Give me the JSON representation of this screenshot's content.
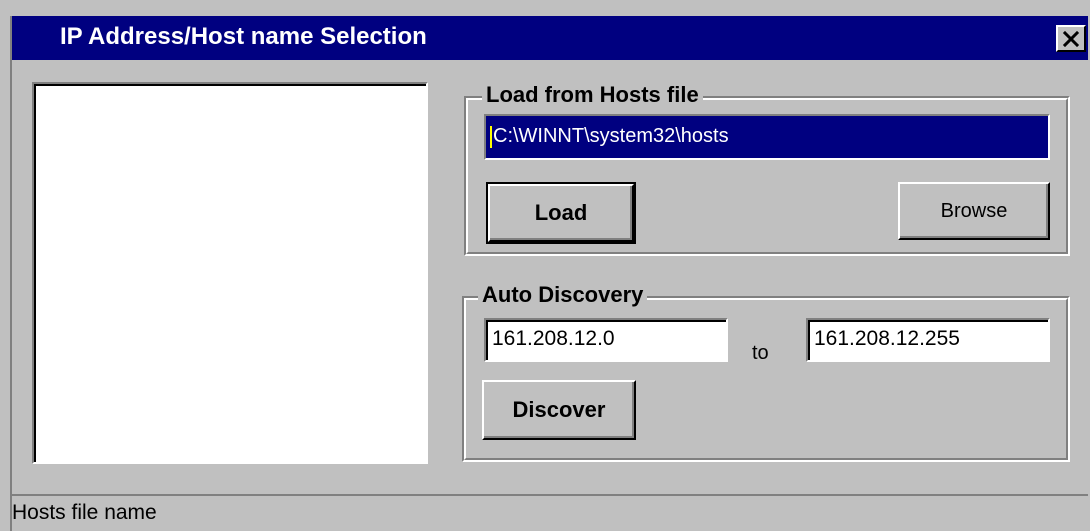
{
  "window": {
    "title": "IP Address/Host name Selection",
    "close_symbol": "×",
    "title_bar_color": "#000080",
    "face_color": "#c0c0c0"
  },
  "hosts_list": {
    "items": []
  },
  "load_group": {
    "label": "Load from Hosts file",
    "path_value": "C:\\WINNT\\system32\\hosts",
    "load_button": "Load",
    "browse_button": "Browse"
  },
  "discovery_group": {
    "label": "Auto Discovery",
    "start_ip": "161.208.12.0",
    "to_label": "to",
    "end_ip": "161.208.12.255",
    "discover_button": "Discover"
  },
  "status_bar": {
    "text": "Hosts file name"
  },
  "icons": {
    "close": "close-icon"
  }
}
